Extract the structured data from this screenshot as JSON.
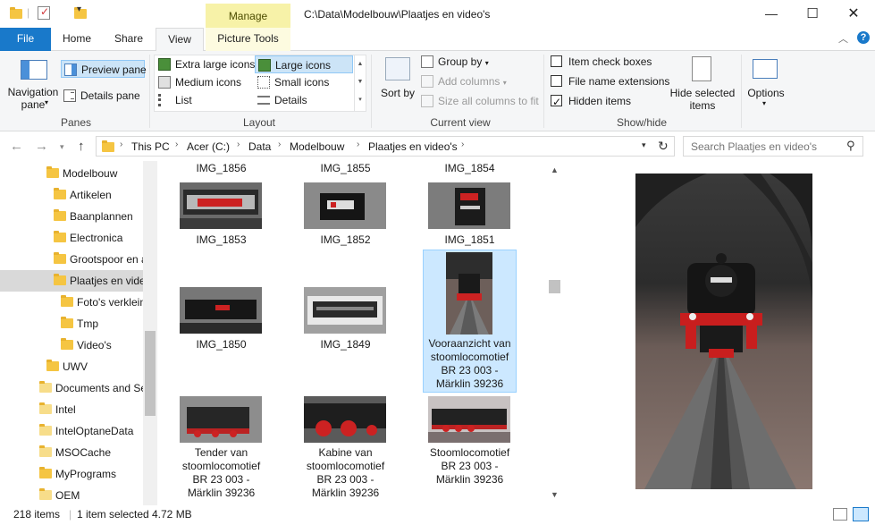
{
  "window": {
    "title": "C:\\Data\\Modelbouw\\Plaatjes en video's",
    "manage_tab": "Manage",
    "controls": {
      "minimize": "—",
      "maximize": "☐",
      "close": "✕"
    }
  },
  "ribbon": {
    "tabs": [
      "File",
      "Home",
      "Share",
      "View",
      "Picture Tools"
    ],
    "active_tab": "View",
    "panes": {
      "group_label": "Panes",
      "navigation_pane": "Navigation pane",
      "preview_pane": "Preview pane",
      "details_pane": "Details pane"
    },
    "layout": {
      "group_label": "Layout",
      "options": [
        "Extra large icons",
        "Large icons",
        "Medium icons",
        "Small icons",
        "List",
        "Details"
      ],
      "selected": "Large icons"
    },
    "current_view": {
      "group_label": "Current view",
      "sort_by": "Sort by",
      "group_by": "Group by",
      "add_columns": "Add columns",
      "size_all_columns": "Size all columns to fit"
    },
    "show_hide": {
      "group_label": "Show/hide",
      "item_check_boxes": "Item check boxes",
      "file_name_extensions": "File name extensions",
      "hidden_items": "Hidden items",
      "item_check_boxes_checked": false,
      "file_name_extensions_checked": false,
      "hidden_items_checked": true,
      "hide_selected_items": "Hide selected items"
    },
    "options": {
      "label": "Options"
    }
  },
  "address": {
    "crumbs": [
      "This PC",
      "Acer (C:)",
      "Data",
      "Modelbouw",
      "Plaatjes en video's"
    ],
    "search_placeholder": "Search Plaatjes en video's"
  },
  "nav_pane": {
    "items": [
      {
        "label": "Modelbouw"
      },
      {
        "label": "Artikelen"
      },
      {
        "label": "Baanplannen"
      },
      {
        "label": "Electronica"
      },
      {
        "label": "Grootspoor en a"
      },
      {
        "label": "Plaatjes en vide"
      },
      {
        "label": "Foto's verklein"
      },
      {
        "label": "Tmp"
      },
      {
        "label": "Video's"
      },
      {
        "label": "UWV"
      },
      {
        "label": "Documents and Se"
      },
      {
        "label": "Intel"
      },
      {
        "label": "IntelOptaneData"
      },
      {
        "label": "MSOCache"
      },
      {
        "label": "MyPrograms"
      },
      {
        "label": "OEM"
      }
    ],
    "selected": "Plaatjes en vide"
  },
  "files": {
    "top_row": [
      "IMG_1856",
      "IMG_1855",
      "IMG_1854"
    ],
    "items": [
      {
        "name": "IMG_1853"
      },
      {
        "name": "IMG_1852"
      },
      {
        "name": "IMG_1851"
      },
      {
        "name": "IMG_1850"
      },
      {
        "name": "IMG_1849"
      },
      {
        "name": "Vooraanzicht van stoomlocomotief BR 23 003 - Märklin 39236"
      },
      {
        "name": "Tender van stoomlocomotief BR 23 003 - Märklin 39236"
      },
      {
        "name": "Kabine van stoomlocomotief BR 23 003 - Märklin 39236"
      },
      {
        "name": "Stoomlocomotief BR 23 003 - Märklin 39236"
      }
    ],
    "selected": "Vooraanzicht van stoomlocomotief BR 23 003 - Märklin 39236"
  },
  "status": {
    "item_count": "218 items",
    "selection": "1 item selected",
    "size": "4.72 MB"
  },
  "colors": {
    "accent": "#1979ca",
    "selection": "#cce8ff",
    "manage_tab": "#f7f2a8",
    "folder": "#f5c542"
  }
}
